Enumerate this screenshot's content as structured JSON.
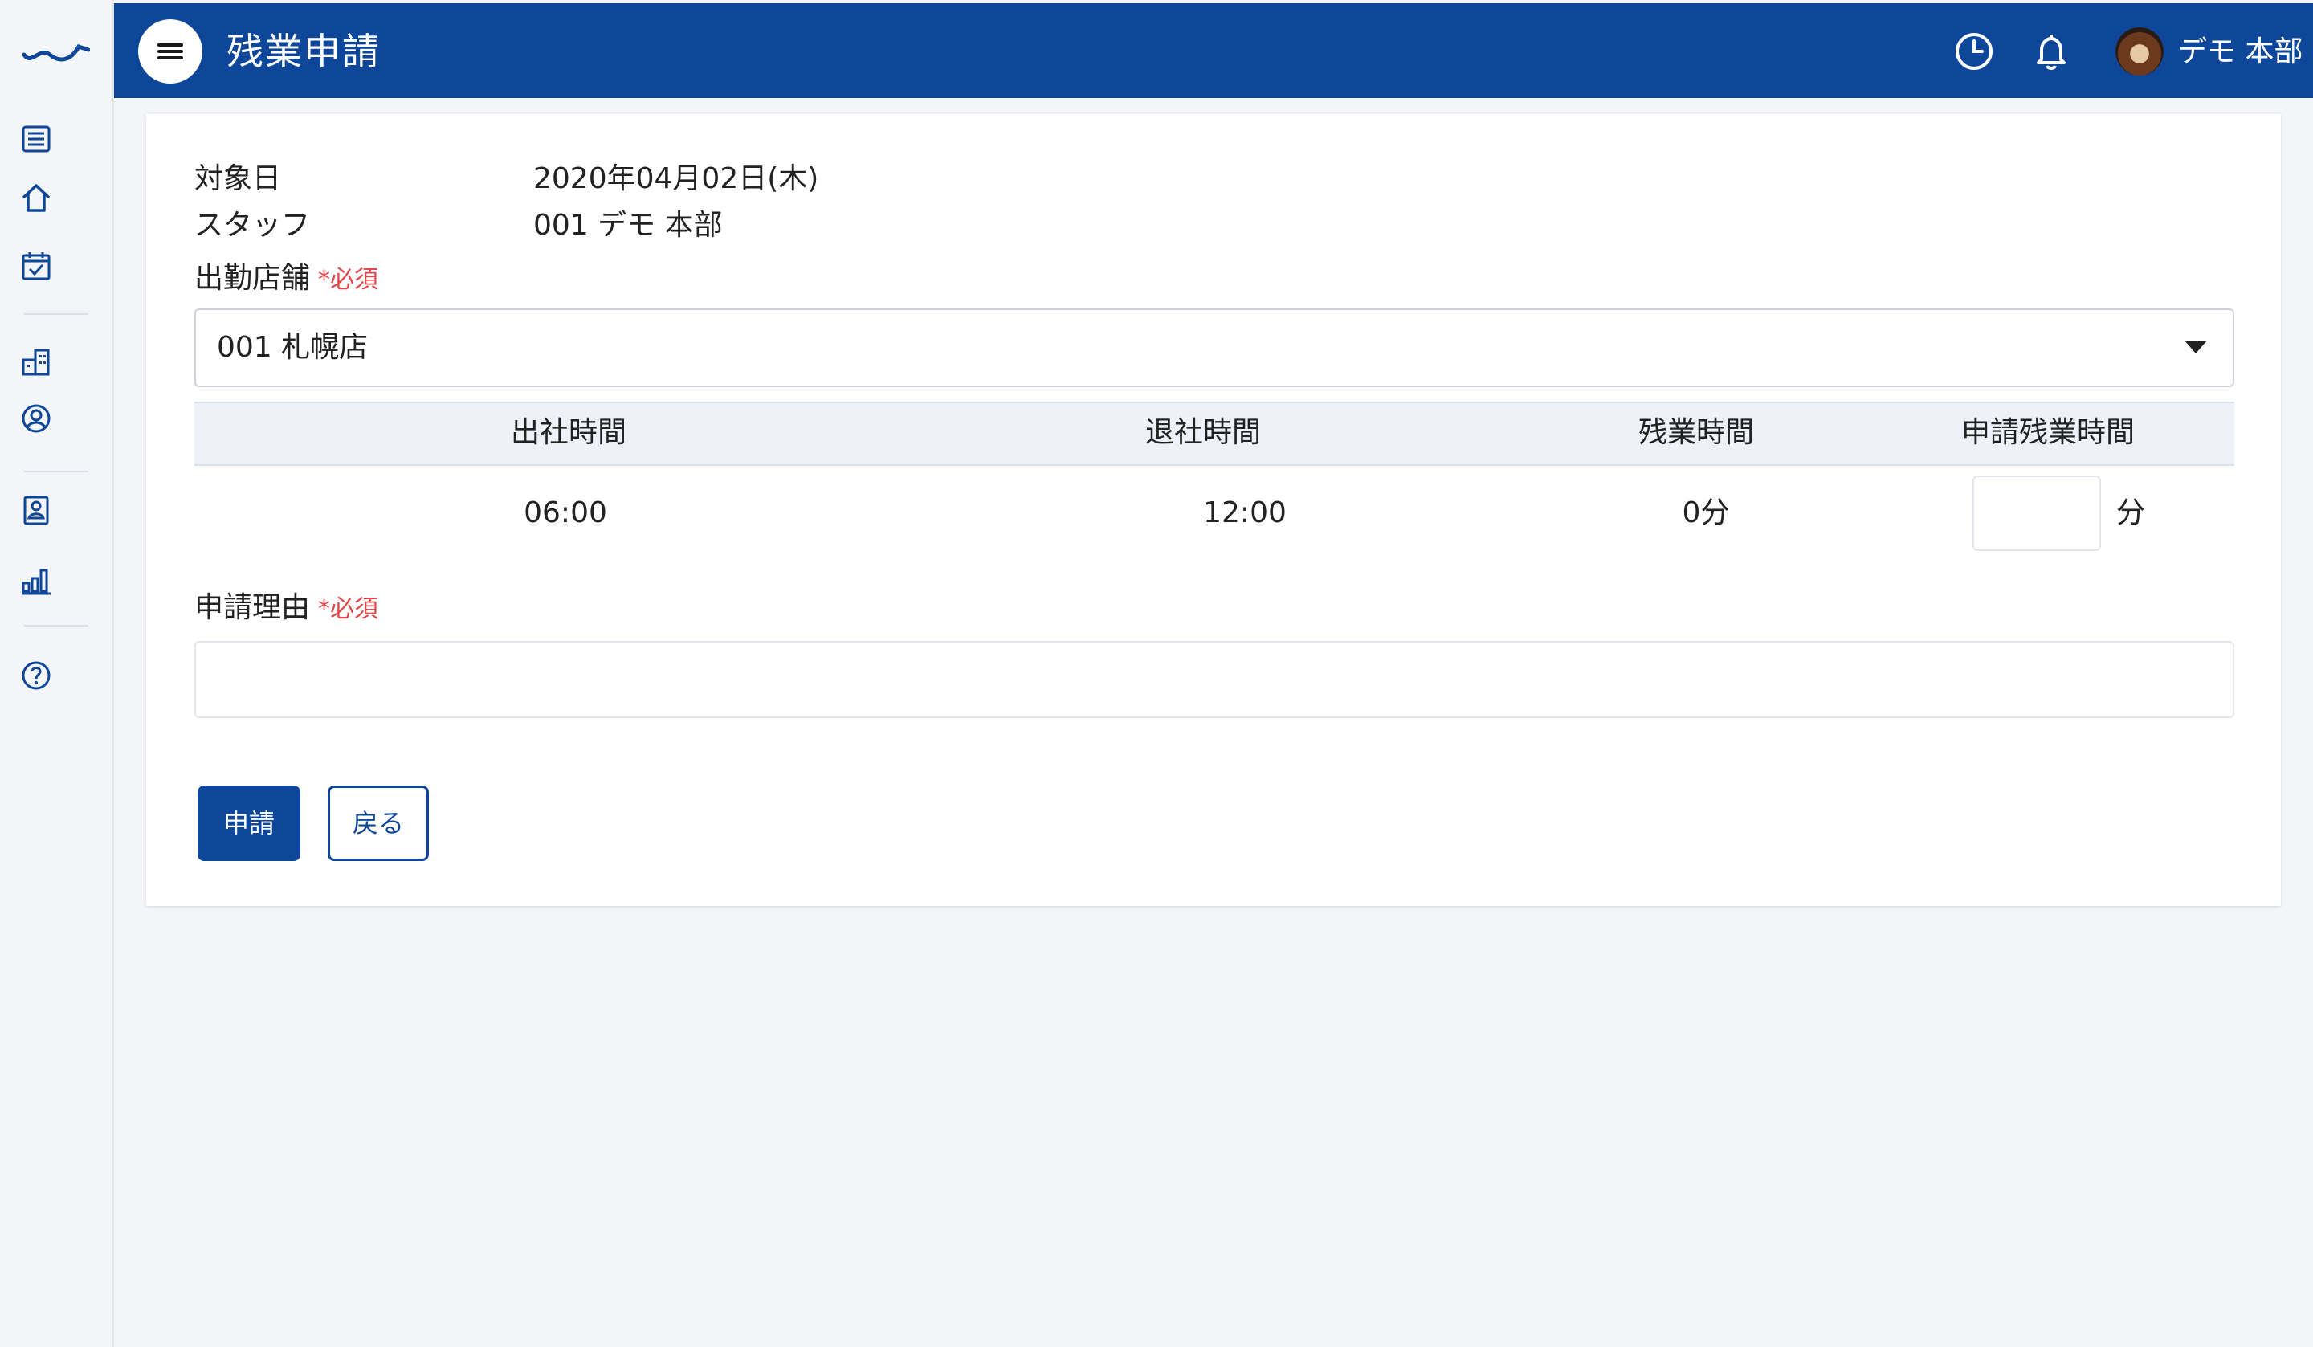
{
  "header": {
    "title": "残業申請",
    "user_name": "デモ 本部"
  },
  "form": {
    "target_date_label": "対象日",
    "target_date_value": "2020年04月02日(木)",
    "staff_label": "スタッフ",
    "staff_value": "001 デモ 本部",
    "store_label": "出勤店舗",
    "required_mark": "*必須",
    "store_selected": "001 札幌店",
    "table": {
      "headers": [
        "出社時間",
        "退社時間",
        "残業時間",
        "申請残業時間"
      ],
      "row": {
        "clock_in": "06:00",
        "clock_out": "12:00",
        "overtime": "0分",
        "requested_overtime": "",
        "requested_unit": "分"
      }
    },
    "reason_label": "申請理由",
    "reason_value": ""
  },
  "buttons": {
    "submit": "申請",
    "back": "戻る"
  },
  "colors": {
    "primary": "#0e4799",
    "required": "#e0464a",
    "background": "#f4f5f8"
  },
  "sidebar": {
    "icons": [
      "list-icon",
      "home-icon",
      "calendar-check-icon",
      "building-icon",
      "user-circle-icon",
      "id-badge-icon",
      "bar-chart-icon",
      "help-icon"
    ]
  }
}
